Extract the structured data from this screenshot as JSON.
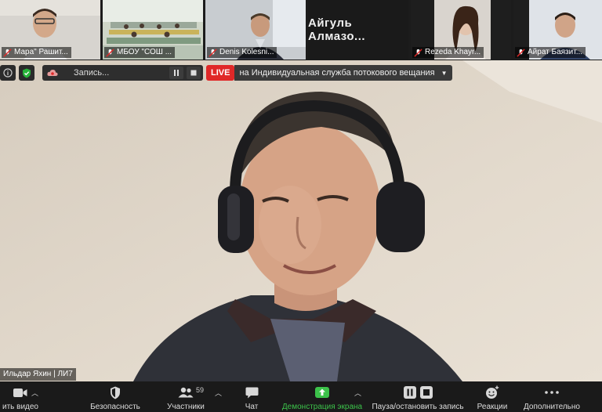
{
  "thumbnails": [
    {
      "name": "Мара\" Рашит...",
      "muted": true
    },
    {
      "name": "МБОУ \"СОШ ...",
      "muted": true
    },
    {
      "name": "Denis Kolesni...",
      "muted": true
    },
    {
      "name": "Айгуль   Алмазо...",
      "muted": false,
      "text_only": true
    },
    {
      "name": "Rezeda Khayr...",
      "muted": true
    },
    {
      "name": "Айрат Баязит...",
      "muted": true
    }
  ],
  "recording": {
    "label": "Запись..."
  },
  "live": {
    "badge": "LIVE",
    "text": "на Индивидуальная служба потокового вещания"
  },
  "main_speaker": {
    "name": "Ильдар Яхин | ЛИ7"
  },
  "toolbar": {
    "video_label": "ить видео",
    "security_label": "Безопасность",
    "participants_label": "Участники",
    "participants_count": "59",
    "chat_label": "Чат",
    "share_label": "Демонстрация экрана",
    "record_label": "Пауза/остановить запись",
    "reactions_label": "Реакции",
    "more_label": "Дополнительно"
  },
  "colors": {
    "share_green": "#3cc24a",
    "live_red": "#e02828"
  }
}
